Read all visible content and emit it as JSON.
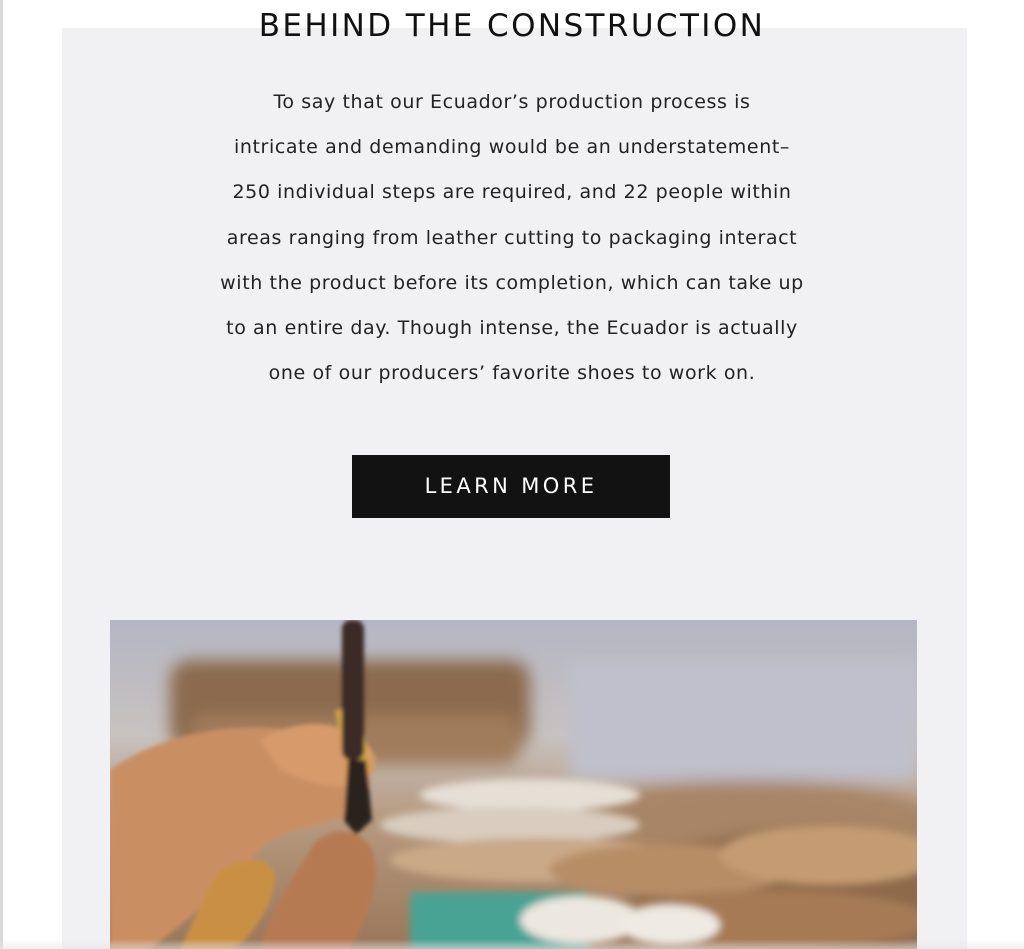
{
  "section": {
    "heading": "BEHIND THE CONSTRUCTION",
    "paragraph_lines": [
      "To say that our Ecuador’s production process is",
      "intricate and demanding would be an understatement–",
      "250 individual steps are required, and 22 people within",
      "areas ranging from leather cutting to packaging interact",
      "with the product before its completion, which can take up",
      "to an entire day. Though intense, the Ecuador is actually",
      "one of our producers’ favorite shoes to work on."
    ],
    "cta_label": "LEARN MORE"
  },
  "colors": {
    "panel_background": "#f1f1f4",
    "button_background": "#121212",
    "button_text": "#ffffff",
    "text": "#222222"
  }
}
